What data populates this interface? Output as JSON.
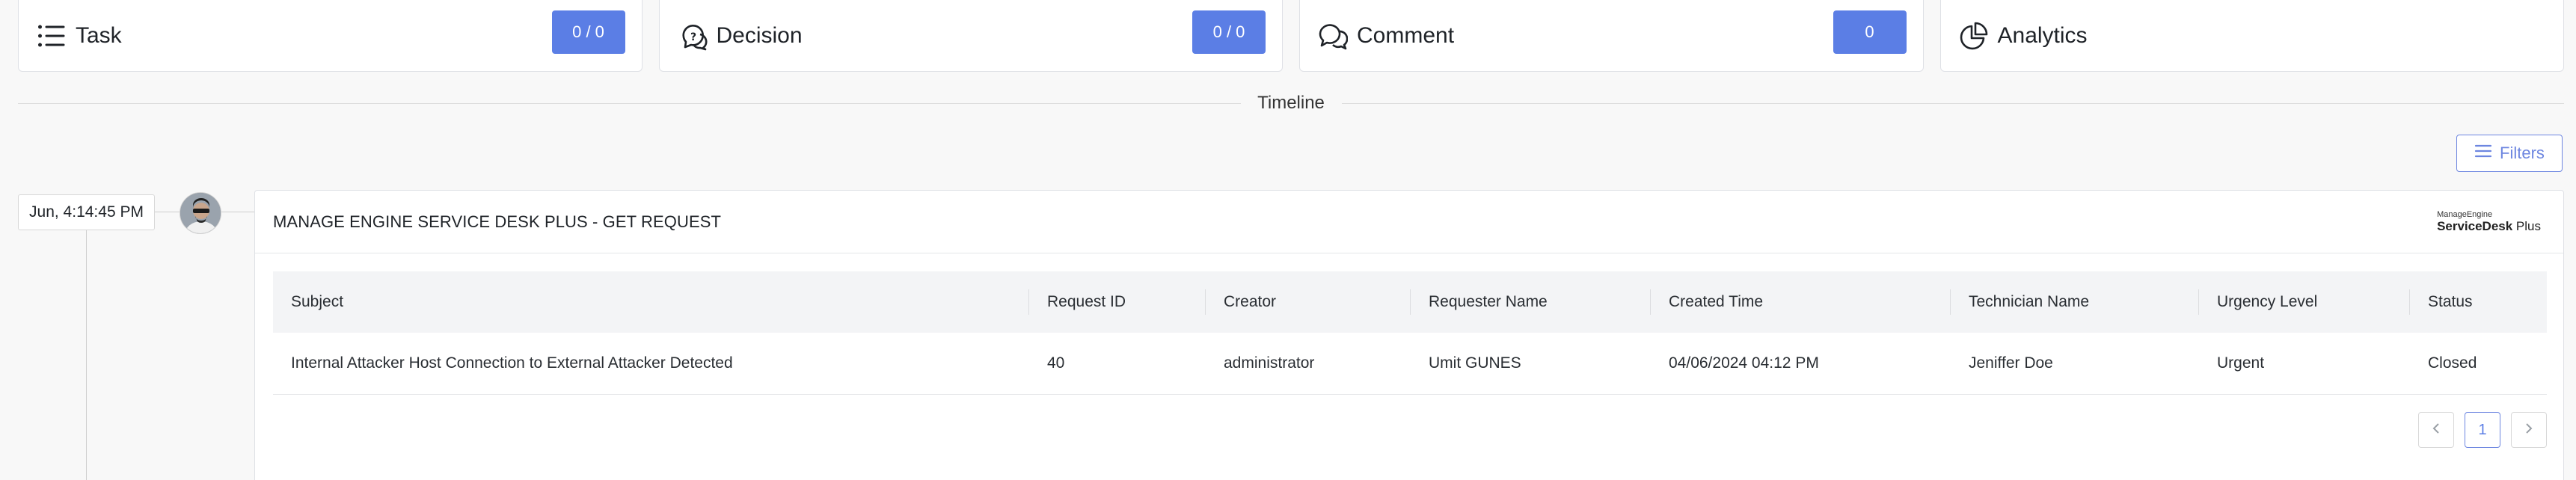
{
  "cards": [
    {
      "title": "Task",
      "icon": "task-list-icon",
      "count": "0 / 0"
    },
    {
      "title": "Decision",
      "icon": "decision-bubble-icon",
      "count": "0 / 0"
    },
    {
      "title": "Comment",
      "icon": "comment-bubbles-icon",
      "count": "0"
    },
    {
      "title": "Analytics",
      "icon": "pie-chart-icon",
      "count": null
    }
  ],
  "timeline": {
    "label": "Timeline"
  },
  "filters": {
    "label": "Filters"
  },
  "entry": {
    "timestamp": "Jun, 4:14:45 PM",
    "title": "MANAGE ENGINE SERVICE DESK PLUS - GET REQUEST",
    "brand": {
      "line1": "ManageEngine",
      "line2_bold": "ServiceDesk",
      "line2_rest": " Plus"
    },
    "table": {
      "headers": [
        "Subject",
        "Request ID",
        "Creator",
        "Requester Name",
        "Created Time",
        "Technician Name",
        "Urgency Level",
        "Status"
      ],
      "rows": [
        [
          "Internal Attacker Host Connection to External Attacker Detected",
          "40",
          "administrator",
          "Umit GUNES",
          "04/06/2024 04:12 PM",
          "Jeniffer Doe",
          "Urgent",
          "Closed"
        ]
      ]
    },
    "pagination": {
      "current_page": "1"
    }
  },
  "colors": {
    "accent": "#5b7ee5",
    "border": "#dfe1e6"
  }
}
